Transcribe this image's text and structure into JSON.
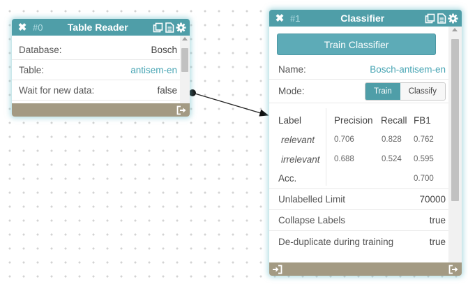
{
  "table_reader": {
    "id": "#0",
    "title": "Table Reader",
    "fields": [
      {
        "label": "Database:",
        "value": "Bosch",
        "link": false
      },
      {
        "label": "Table:",
        "value": "antisem-en",
        "link": true
      },
      {
        "label": "Wait for new data:",
        "value": "false",
        "link": false
      }
    ]
  },
  "classifier": {
    "id": "#1",
    "title": "Classifier",
    "train_button": "Train Classifier",
    "name_label": "Name:",
    "name_value": "Bosch-antisem-en",
    "mode_label": "Mode:",
    "mode_options": [
      "Train",
      "Classify"
    ],
    "mode_selected": "Train",
    "metrics": {
      "headers": [
        "Label",
        "Precision",
        "Recall",
        "FB1"
      ],
      "rows": [
        {
          "label": "relevant",
          "precision": "0.706",
          "recall": "0.828",
          "fb1": "0.762"
        },
        {
          "label": "irrelevant",
          "precision": "0.688",
          "recall": "0.524",
          "fb1": "0.595"
        }
      ],
      "acc_label": "Acc.",
      "acc_value": "0.700"
    },
    "settings": [
      {
        "label": "Unlabelled Limit",
        "value": "70000"
      },
      {
        "label": "Collapse Labels",
        "value": "true"
      },
      {
        "label": "De-duplicate during training",
        "value": "true"
      }
    ]
  },
  "icons": {
    "close": "close-icon",
    "copy": "copy-icon",
    "document": "document-icon",
    "settings": "gear-icon",
    "output_port": "output-port-icon",
    "input_port": "input-port-icon"
  },
  "colors": {
    "header": "#4f9ea8",
    "footer": "#a39a83",
    "accent_link": "#48a5b4",
    "button": "#5dabb7"
  }
}
